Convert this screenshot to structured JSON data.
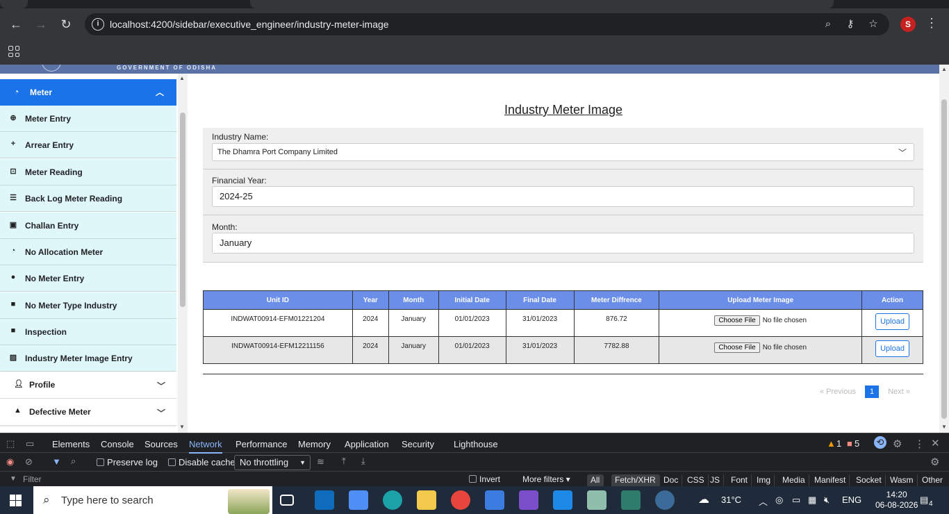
{
  "browser": {
    "url": "localhost:4200/sidebar/executive_engineer/industry-meter-image",
    "avatar_letter": "S"
  },
  "header": {
    "gov_text": "GOVERNMENT OF ODISHA"
  },
  "sidebar": {
    "section": "Meter",
    "items": [
      {
        "label": "Meter Entry",
        "icon": "plus-circle-icon"
      },
      {
        "label": "Arrear Entry",
        "icon": "plus-icon"
      },
      {
        "label": "Meter Reading",
        "icon": "search-box-icon"
      },
      {
        "label": "Back Log Meter Reading",
        "icon": "list-icon"
      },
      {
        "label": "Challan Entry",
        "icon": "file-plus-icon"
      },
      {
        "label": "No Allocation Meter",
        "icon": "gauge-icon"
      },
      {
        "label": "No Meter Entry",
        "icon": "alert-circle-icon"
      },
      {
        "label": "No Meter Type Industry",
        "icon": "briefcase-icon"
      },
      {
        "label": "Inspection",
        "icon": "briefcase-icon"
      },
      {
        "label": "Industry Meter Image Entry",
        "icon": "image-plus-icon"
      }
    ],
    "profile": "Profile",
    "defective": "Defective Meter"
  },
  "main": {
    "title": "Industry Meter Image",
    "industry_label": "Industry Name:",
    "industry_value": "The Dhamra Port Company Limited",
    "fy_label": "Financial Year:",
    "fy_value": "2024-25",
    "month_label": "Month:",
    "month_value": "January"
  },
  "table": {
    "headers": [
      "Unit ID",
      "Year",
      "Month",
      "Initial Date",
      "Final Date",
      "Meter Diffrence",
      "Upload Meter Image",
      "Action"
    ],
    "rows": [
      {
        "unit_id": "INDWAT00914-EFM01221204",
        "year": "2024",
        "month": "January",
        "initial": "01/01/2023",
        "final": "31/01/2023",
        "diff": "876.72"
      },
      {
        "unit_id": "INDWAT00914-EFM12211156",
        "year": "2024",
        "month": "January",
        "initial": "01/01/2023",
        "final": "31/01/2023",
        "diff": "7782.88"
      }
    ],
    "choose_file": "Choose File",
    "no_file": "No file chosen",
    "upload": "Upload"
  },
  "pager": {
    "prev": "« Previous",
    "current": "1",
    "next": "Next »"
  },
  "devtools": {
    "tabs": [
      "Elements",
      "Console",
      "Sources",
      "Network",
      "Performance",
      "Memory",
      "Application",
      "Security",
      "Lighthouse"
    ],
    "warnings": "1",
    "errors": "5",
    "preserve_log": "Preserve log",
    "disable_cache": "Disable cache",
    "throttling": "No throttling",
    "filter": "Filter",
    "invert": "Invert",
    "more_filters": "More filters",
    "chips": [
      "All",
      "Fetch/XHR",
      "Doc",
      "CSS",
      "JS",
      "Font",
      "Img",
      "Media",
      "Manifest",
      "Socket",
      "Wasm",
      "Other"
    ]
  },
  "taskbar": {
    "search_placeholder": "Type here to search",
    "temp": "31°C",
    "lang": "ENG",
    "time": "14:20",
    "date": "06-08-2026",
    "notif": "4"
  }
}
